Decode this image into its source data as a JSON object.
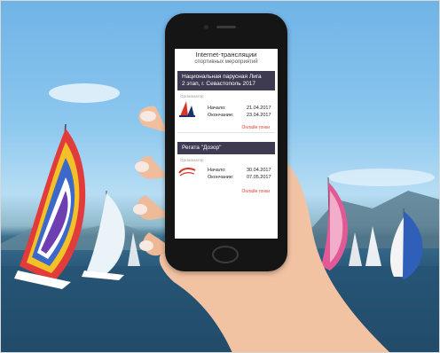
{
  "app": {
    "title": "Internet-трансляции",
    "subtitle": "спортивных мероприятий"
  },
  "events": [
    {
      "name_line1": "Национальная парусная Лига",
      "name_line2": "2 этап, г. Севастополь 2017",
      "organizer": "Организатор",
      "start_label": "Начало:",
      "start_date": "21.04.2017",
      "end_label": "Окончание:",
      "end_date": "23.04.2017",
      "link": "Онлайн гонки"
    },
    {
      "name_line1": "Регата \"Дозор\"",
      "name_line2": "",
      "organizer": "Организатор",
      "start_label": "Начало:",
      "start_date": "30.04.2017",
      "end_label": "Окончание:",
      "end_date": "07.05.2017",
      "link": "Онлайн гонки"
    }
  ],
  "colors": {
    "header_bg": "#3e3a52",
    "link": "#e0412f",
    "sea": "#2b5b7d",
    "sky": "#8cc7ee"
  }
}
